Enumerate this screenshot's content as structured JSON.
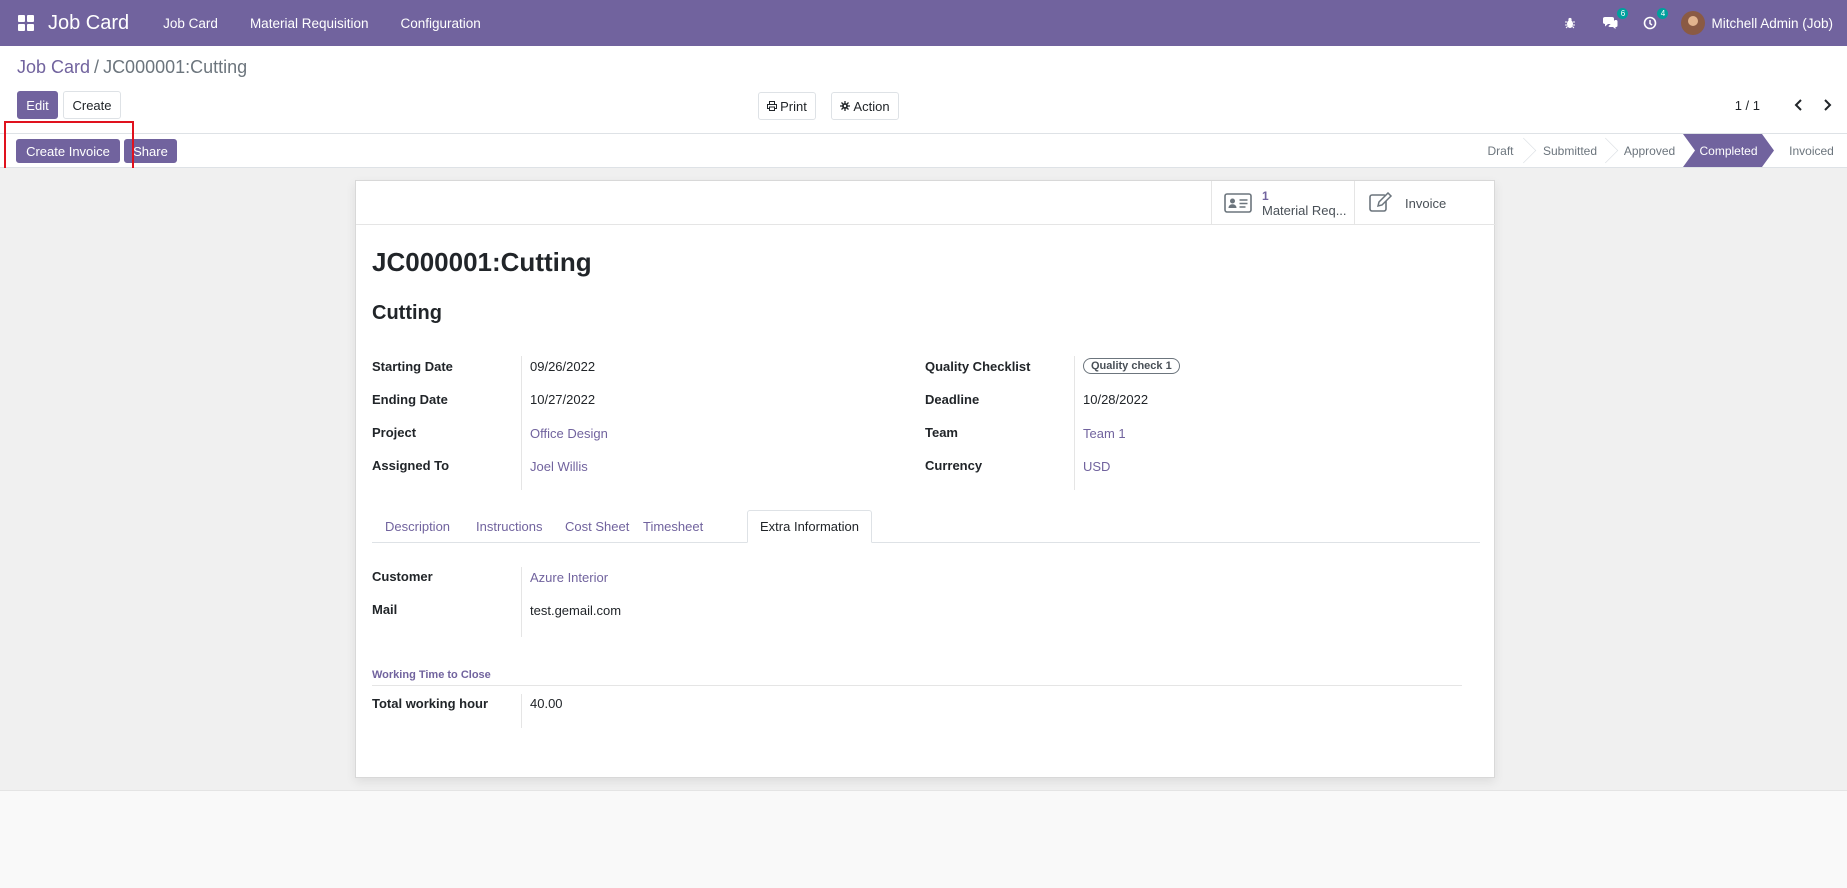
{
  "navbar": {
    "app_name": "Job Card",
    "menu": [
      "Job Card",
      "Material Requisition",
      "Configuration"
    ],
    "messages_count": "6",
    "activities_count": "4",
    "user_name": "Mitchell Admin (Job)"
  },
  "breadcrumb": {
    "parent": "Job Card",
    "separator": "/",
    "current": "JC000001:Cutting"
  },
  "toolbar": {
    "edit_label": "Edit",
    "create_label": "Create",
    "print_label": "Print",
    "action_label": "Action",
    "pager": "1 / 1"
  },
  "statusbar": {
    "create_invoice_label": "Create Invoice",
    "share_label": "Share",
    "stages": [
      "Draft",
      "Submitted",
      "Approved",
      "Completed",
      "Invoiced"
    ],
    "active_stage": "Completed"
  },
  "smart_buttons": {
    "material_count": "1",
    "material_label": "Material Req...",
    "invoice_label": "Invoice"
  },
  "form": {
    "title": "JC000001:Cutting",
    "subtitle": "Cutting",
    "left_fields": [
      {
        "label": "Starting Date",
        "value": "09/26/2022"
      },
      {
        "label": "Ending Date",
        "value": "10/27/2022"
      },
      {
        "label": "Project",
        "value": "Office Design"
      },
      {
        "label": "Assigned To",
        "value": "Joel Willis"
      }
    ],
    "right_fields": [
      {
        "label": "Quality Checklist",
        "value": "Quality check 1"
      },
      {
        "label": "Deadline",
        "value": "10/28/2022"
      },
      {
        "label": "Team",
        "value": "Team 1"
      },
      {
        "label": "Currency",
        "value": "USD"
      }
    ],
    "tabs": [
      "Description",
      "Instructions",
      "Cost Sheet",
      "Timesheet",
      "Extra Information"
    ],
    "active_tab": "Extra Information",
    "extra": [
      {
        "label": "Customer",
        "value": "Azure Interior"
      },
      {
        "label": "Mail",
        "value": "test.gemail.com"
      }
    ],
    "section_title": "Working Time to Close",
    "total_label": "Total working hour",
    "total_value": "40.00"
  },
  "colors": {
    "brand": "#71639e",
    "badge": "#00a09d",
    "highlight": "#e0121e"
  }
}
